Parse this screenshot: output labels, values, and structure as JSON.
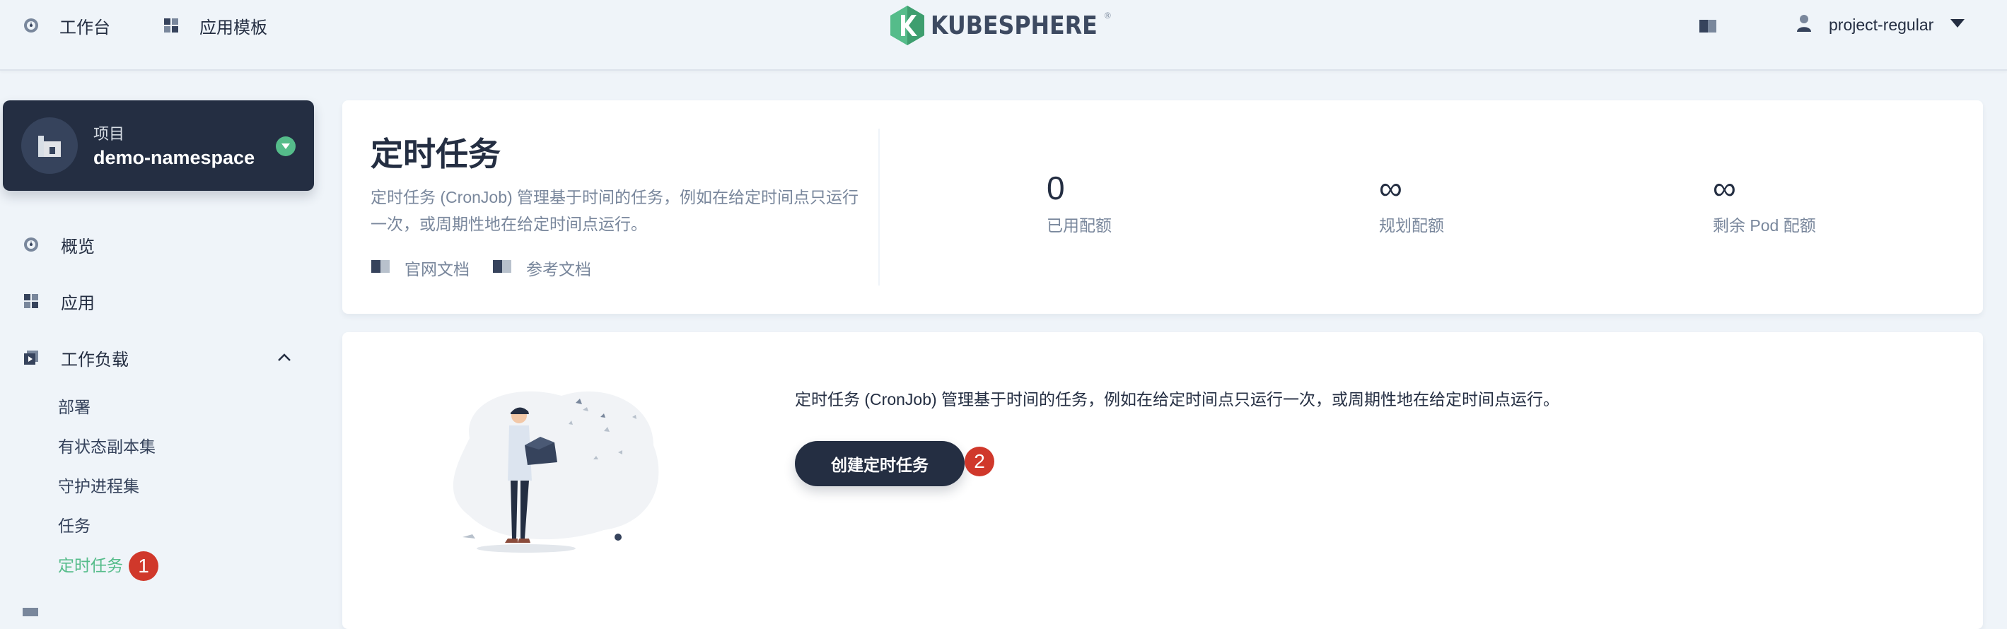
{
  "topbar": {
    "workbench_label": "工作台",
    "templates_label": "应用模板",
    "logo_text": "KUBESPHERE",
    "logo_reg": "®",
    "username": "project-regular"
  },
  "sidebar": {
    "project_type": "项目",
    "project_name": "demo-namespace",
    "items": [
      {
        "label": "概览",
        "icon": "dashboard-icon"
      },
      {
        "label": "应用",
        "icon": "apps-icon"
      },
      {
        "label": "工作负载",
        "icon": "workloads-icon"
      }
    ],
    "workload_sub_items": [
      {
        "label": "部署"
      },
      {
        "label": "有状态副本集"
      },
      {
        "label": "守护进程集"
      },
      {
        "label": "任务"
      },
      {
        "label": "定时任务",
        "active": true
      }
    ]
  },
  "header": {
    "title": "定时任务",
    "description": "定时任务 (CronJob) 管理基于时间的任务，例如在给定时间点只运行一次，或周期性地在给定时间点运行。",
    "doc_official": "官网文档",
    "doc_reference": "参考文档",
    "quotas": [
      {
        "value": "0",
        "label": "已用配额"
      },
      {
        "value": "∞",
        "label": "规划配额"
      },
      {
        "value": "∞",
        "label": "剩余 Pod 配额"
      }
    ]
  },
  "empty_state": {
    "description": "定时任务 (CronJob) 管理基于时间的任务，例如在给定时间点只运行一次，或周期性地在给定时间点运行。",
    "create_button": "创建定时任务"
  },
  "annotations": {
    "badge_1": "1",
    "badge_2": "2"
  },
  "colors": {
    "accent_green": "#55bc8a",
    "dark_navy": "#242e42",
    "badge_red": "#d0382b",
    "page_bg": "#eff4f9"
  }
}
